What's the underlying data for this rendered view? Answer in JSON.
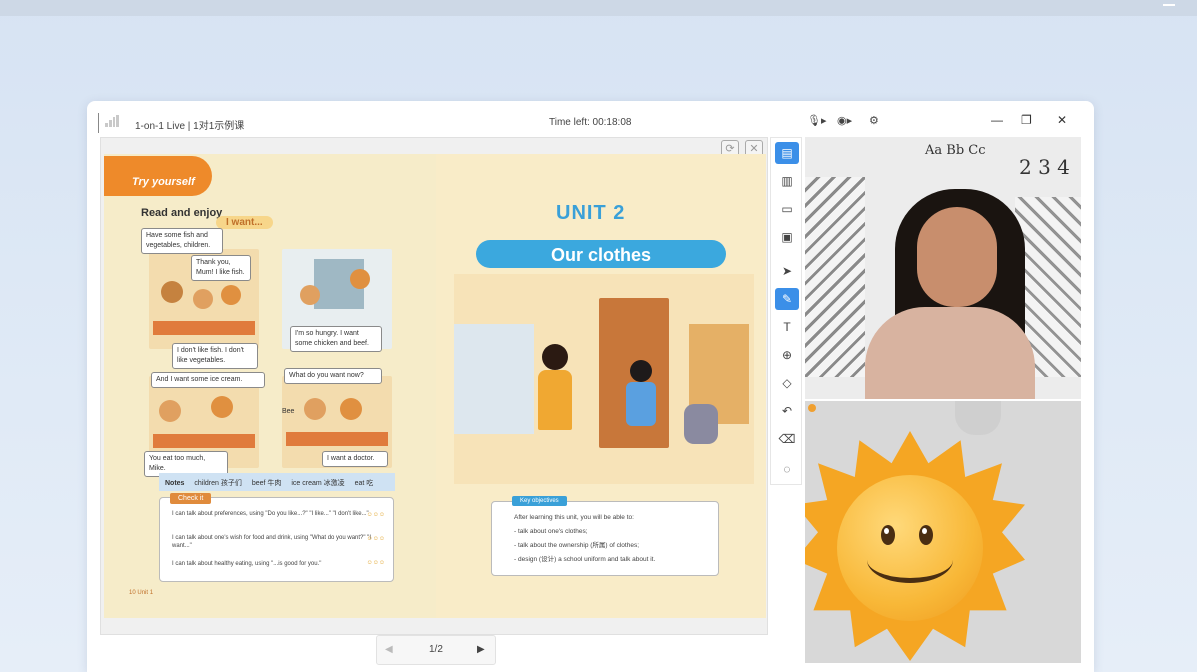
{
  "app": {
    "title": "1-on-1 Live | 1对1示例课",
    "time_left": "Time left: 00:18:08"
  },
  "titlebar": {
    "mic_icon": "mic-icon",
    "camera_icon": "camera-icon",
    "settings_icon": "gear-icon",
    "minimize_label": "—",
    "restore_label": "❐",
    "close_label": "✕"
  },
  "board": {
    "left_page": {
      "banner": "Try yourself",
      "section_title": "Read and enjoy",
      "theme": "I want...",
      "bubbles": [
        "Have some fish and vegetables, children.",
        "Thank you, Mum! I like fish.",
        "I'm so hungry. I want some chicken and beef.",
        "I don't like fish. I don't like vegetables.",
        "And I want some ice cream.",
        "What do you want now?",
        "You eat too much, Mike.",
        "I want a doctor."
      ],
      "speaker_label": "Bee",
      "notes_label": "Notes",
      "notes": [
        "children 孩子们",
        "beef 牛肉",
        "ice cream 冰激凌",
        "eat 吃"
      ],
      "check_it_title": "Check it",
      "check_it_items": [
        "I can talk about preferences, using \"Do you like...?\" \"I like...\" \"I don't like...\"",
        "I can talk about one's wish for food and drink, using \"What do you want?\" \"I want...\"",
        "I can talk about healthy eating, using \"...is good for you.\""
      ],
      "page_number": "10",
      "page_footer": "Unit 1"
    },
    "right_page": {
      "unit": "UNIT 2",
      "title": "Our clothes",
      "key_objectives_title": "Key objectives",
      "objectives": [
        "After learning this unit, you will be able to:",
        "- talk about one's clothes;",
        "- talk about the ownership (所属) of clothes;",
        "- design (设计) a school uniform and talk about it."
      ]
    },
    "pager": {
      "prev": "◀",
      "page": "1/2",
      "next": "▶"
    }
  },
  "toolbar": {
    "tools": [
      {
        "name": "courseware-icon",
        "glyph": "▤",
        "active": true
      },
      {
        "name": "doc-icon",
        "glyph": "▥",
        "active": false
      },
      {
        "name": "screen-icon",
        "glyph": "▭",
        "active": false
      },
      {
        "name": "folder-icon",
        "glyph": "▣",
        "active": false
      },
      {
        "name": "pointer-icon",
        "glyph": "➤",
        "active": false
      },
      {
        "name": "laser-icon",
        "glyph": "✎",
        "active": true
      },
      {
        "name": "text-icon",
        "glyph": "T",
        "active": false
      },
      {
        "name": "zoom-icon",
        "glyph": "⊕",
        "active": false
      },
      {
        "name": "eraser-icon",
        "glyph": "◇",
        "active": false
      },
      {
        "name": "undo-icon",
        "glyph": "↶",
        "active": false
      },
      {
        "name": "clear-icon",
        "glyph": "⌫",
        "active": false
      },
      {
        "name": "chat-icon",
        "glyph": "◌",
        "active": false
      }
    ]
  },
  "video": {
    "teacher_wall_text": "Aa Bb Cc",
    "teacher_wall_numbers": "2 3 4",
    "student_overlay": "sun-emoji"
  },
  "colors": {
    "accent": "#3b8fe8",
    "banner_orange": "#ee8a2a",
    "unit_blue": "#3ba8de"
  }
}
